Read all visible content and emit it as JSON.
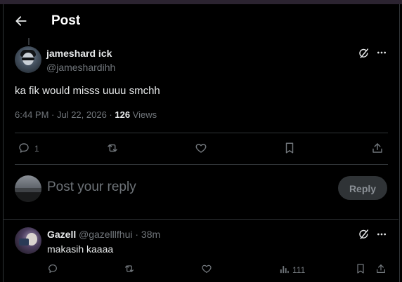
{
  "header": {
    "title": "Post",
    "back_icon": "arrow-left-icon"
  },
  "post": {
    "display_name": "jameshard ick",
    "handle": "@jameshardihh",
    "text": "ka fik would misss uuuu smchh",
    "time": "6:44 PM · Jul 22, 2026 · ",
    "views_count": "126",
    "views_label": " Views",
    "actions": {
      "reply_count": "1",
      "retweet_count": "",
      "like_count": ""
    }
  },
  "composer": {
    "placeholder": "Post your reply",
    "button_label": "Reply"
  },
  "reply": {
    "display_name": "Gazell",
    "handle_time": "@gazelllfhui · 38m",
    "text": "makasih kaaaa",
    "views_count": "111"
  },
  "colors": {
    "background": "#000000",
    "text": "#e7e9ea",
    "muted": "#71767b",
    "divider": "#2f3336",
    "reply_button_bg": "#2f3336"
  }
}
